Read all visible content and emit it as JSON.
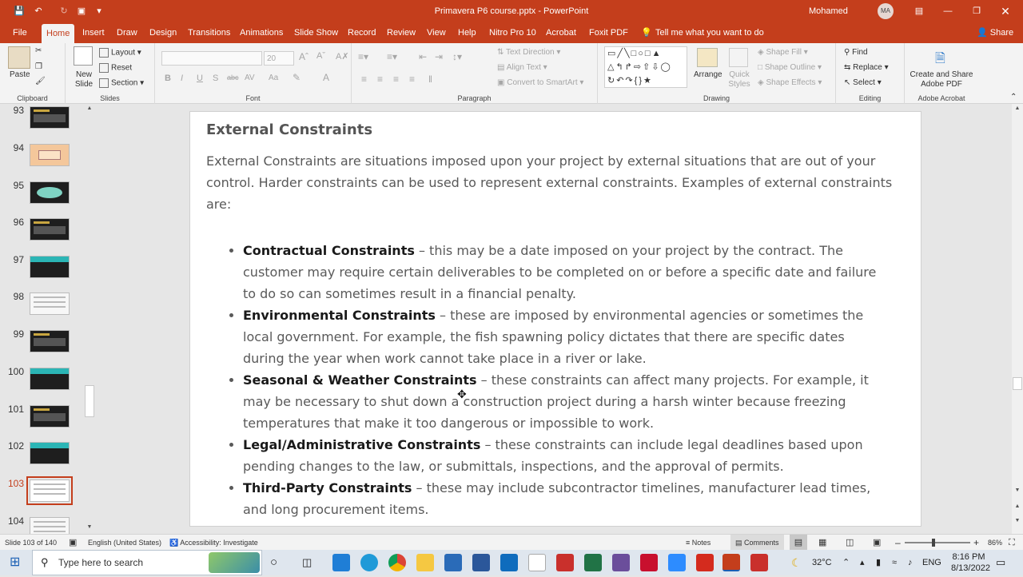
{
  "titlebar": {
    "title": "Primavera P6 course.pptx  -  PowerPoint",
    "user": "Mohamed Abbas",
    "avatar_initials": "MA"
  },
  "tabs": [
    "File",
    "Home",
    "Insert",
    "Draw",
    "Design",
    "Transitions",
    "Animations",
    "Slide Show",
    "Record",
    "Review",
    "View",
    "Help",
    "Nitro Pro 10",
    "Acrobat",
    "Foxit PDF"
  ],
  "tell_me": "Tell me what you want to do",
  "share": "Share",
  "ribbon": {
    "clipboard": {
      "paste": "Paste",
      "label": "Clipboard"
    },
    "slides": {
      "new_slide": "New Slide",
      "layout": "Layout",
      "reset": "Reset",
      "section": "Section",
      "label": "Slides"
    },
    "font": {
      "size": "20",
      "label": "Font"
    },
    "paragraph": {
      "text_direction": "Text Direction",
      "align_text": "Align Text",
      "convert_smartart": "Convert to SmartArt",
      "label": "Paragraph"
    },
    "drawing": {
      "arrange": "Arrange",
      "quick_styles": "Quick Styles",
      "shape_fill": "Shape Fill",
      "shape_outline": "Shape Outline",
      "shape_effects": "Shape Effects",
      "label": "Drawing"
    },
    "editing": {
      "find": "Find",
      "replace": "Replace",
      "select": "Select",
      "label": "Editing"
    },
    "acrobat": {
      "create_share": "Create and Share Adobe PDF",
      "label": "Adobe Acrobat"
    }
  },
  "thumbnails": [
    {
      "num": "93",
      "selected": false,
      "style": "dark"
    },
    {
      "num": "94",
      "selected": false,
      "style": "peach"
    },
    {
      "num": "95",
      "selected": false,
      "style": "diagram"
    },
    {
      "num": "96",
      "selected": false,
      "style": "dark"
    },
    {
      "num": "97",
      "selected": false,
      "style": "teal"
    },
    {
      "num": "98",
      "selected": false,
      "style": "light"
    },
    {
      "num": "99",
      "selected": false,
      "style": "dark"
    },
    {
      "num": "100",
      "selected": false,
      "style": "teal"
    },
    {
      "num": "101",
      "selected": false,
      "style": "dark"
    },
    {
      "num": "102",
      "selected": false,
      "style": "teal"
    },
    {
      "num": "103",
      "selected": true,
      "style": "white"
    },
    {
      "num": "104",
      "selected": false,
      "style": "light"
    }
  ],
  "slide": {
    "heading": "External Constraints",
    "intro": "External Constraints are situations imposed upon your project by external situations that are out of your control. Harder constraints can be used to represent external constraints. Examples of external constraints are:",
    "bullets": [
      {
        "title": "Contractual Constraints",
        "text": " – this may be a date imposed on your project by the contract. The customer may require certain deliverables to be completed on or before a specific date and failure to do so can sometimes result in a financial penalty."
      },
      {
        "title": "Environmental Constraints",
        "text": " – these are imposed by environmental agencies or sometimes the local government. For example, the fish spawning policy dictates that there are specific dates during the year when work cannot take place in a river or lake."
      },
      {
        "title": "Seasonal & Weather Constraints",
        "text": " – these constraints can affect many projects. For example, it may be necessary to shut down a construction project during a harsh winter because freezing temperatures that make it too dangerous or impossible to work."
      },
      {
        "title": "Legal/Administrative Constraints",
        "text": " – these constraints can include legal deadlines based upon pending changes to the law, or submittals, inspections, and the approval of permits."
      },
      {
        "title": "Third-Party Constraints",
        "text": " – these may include subcontractor timelines, manufacturer lead times, and long procurement items."
      }
    ]
  },
  "status": {
    "slide_count": "Slide 103 of 140",
    "language": "English (United States)",
    "accessibility": "Accessibility: Investigate",
    "notes": "Notes",
    "comments": "Comments",
    "zoom": "86%"
  },
  "taskbar": {
    "search_placeholder": "Type here to search",
    "weather": "32°C",
    "lang": "ENG",
    "time": "8:16 PM",
    "date": "8/13/2022"
  },
  "colors": {
    "accent": "#c43e1c"
  }
}
